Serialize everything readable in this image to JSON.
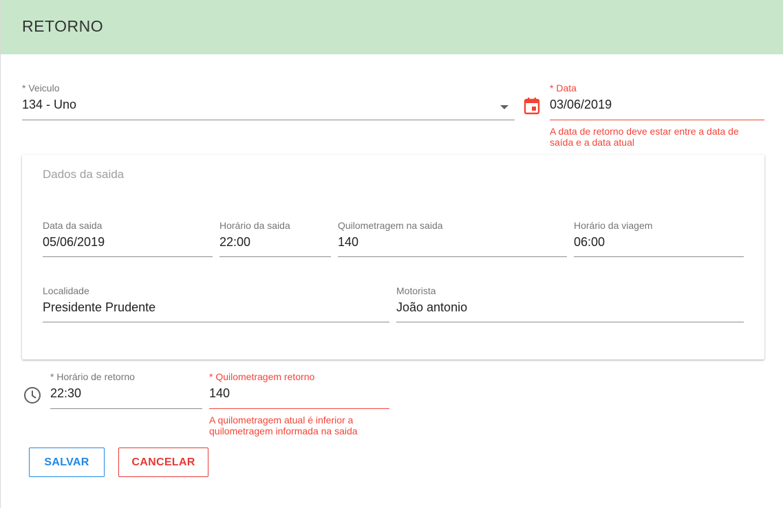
{
  "header": {
    "title": "RETORNO"
  },
  "veiculo": {
    "label": "* Veiculo",
    "value": "134 - Uno"
  },
  "data": {
    "label": "* Data",
    "value": "03/06/2019",
    "error_line1": "A data de retorno deve estar entre a data de",
    "error_line2": "saída e a data atual"
  },
  "saida": {
    "title": "Dados da saida",
    "data_saida": {
      "label": "Data da saida",
      "value": "05/06/2019"
    },
    "horario_saida": {
      "label": "Horário da saida",
      "value": "22:00"
    },
    "quilometragem_saida": {
      "label": "Quilometragem na saida",
      "value": "140"
    },
    "horario_viagem": {
      "label": "Horário da viagem",
      "value": "06:00"
    },
    "localidade": {
      "label": "Localidade",
      "value": "Presidente Prudente"
    },
    "motorista": {
      "label": "Motorista",
      "value": "João antonio"
    }
  },
  "horario_retorno": {
    "label": "* Horário de retorno",
    "value": "22:30"
  },
  "quilometragem_retorno": {
    "label": "* Quilometragem retorno",
    "value": "140",
    "error_line1": "A quilometragem atual é inferior a",
    "error_line2": "quilometragem informada na saida"
  },
  "buttons": {
    "save": "SALVAR",
    "cancel": "CANCELAR"
  },
  "icons": {
    "date": "calendar-icon",
    "time": "clock-icon",
    "select": "chevron-down-icon"
  },
  "colors": {
    "header_bg": "#c8e6c9",
    "error": "#f44336",
    "primary": "#1e88e5",
    "cancel": "#e53935"
  }
}
